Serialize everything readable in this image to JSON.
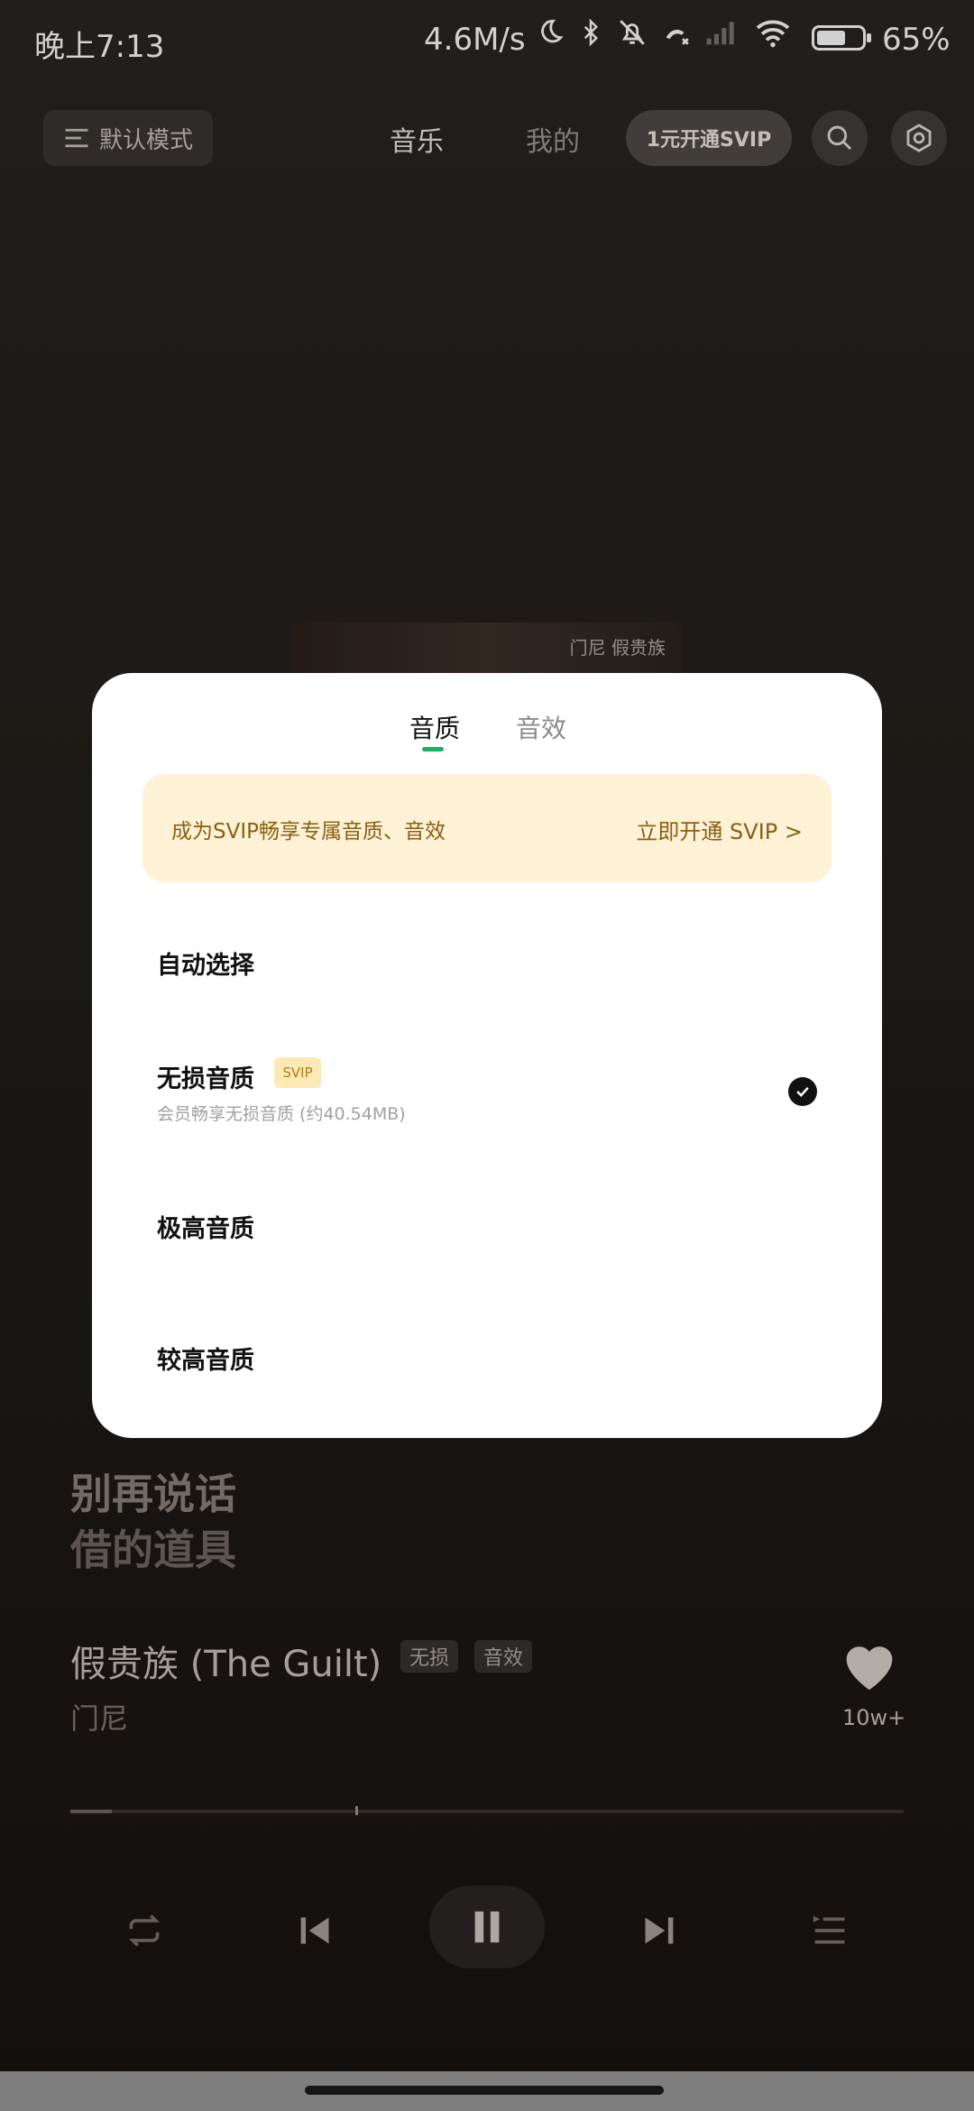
{
  "status_bar": {
    "time": "晚上7:13",
    "speed": "4.6M/s",
    "battery_percent": "65%",
    "battery_level": 0.65,
    "icons": [
      "moon-icon",
      "bluetooth-icon",
      "bell-off-icon",
      "call-missed-icon",
      "signal-icon",
      "wifi-icon",
      "battery-icon"
    ]
  },
  "header": {
    "mode_label": "默认模式",
    "tabs": [
      "音乐",
      "我的"
    ],
    "svip_button": "1元开通SVIP"
  },
  "album": {
    "caption": "门尼 假贵族"
  },
  "sheet": {
    "tabs": [
      "音质",
      "音效"
    ],
    "promo_text": "成为SVIP畅享专属音质、音效",
    "promo_cta": "立即开通 SVIP >",
    "options": [
      {
        "label": "自动选择"
      },
      {
        "label": "无损音质",
        "badge": "SVIP",
        "subtitle": "会员畅享无损音质 (约40.54MB)",
        "selected": true
      },
      {
        "label": "极高音质"
      },
      {
        "label": "较高音质"
      }
    ]
  },
  "player": {
    "lyrics": [
      "别再说话",
      "借的道具"
    ],
    "song_title": "假贵族 (The Guilt)",
    "tags": [
      "无损",
      "音效"
    ],
    "artist": "门尼",
    "like_count": "10w+",
    "progress": 0.05
  },
  "colors": {
    "accent_green": "#1ab067",
    "promo_bg": "#fdf2d6",
    "promo_text": "#8a5f12"
  }
}
